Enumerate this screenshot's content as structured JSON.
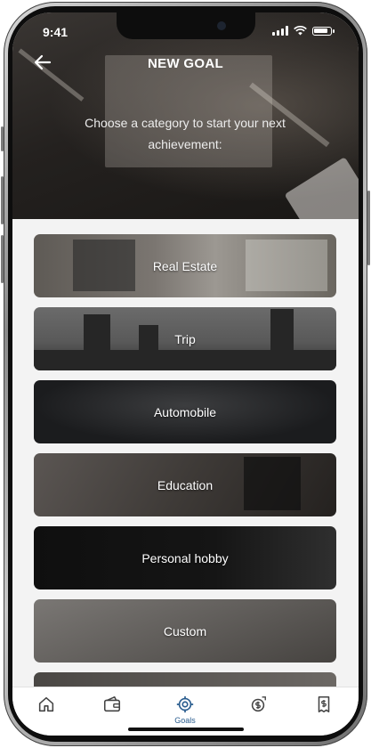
{
  "status_bar": {
    "time": "9:41"
  },
  "header": {
    "title": "NEW GOAL",
    "subtitle": "Choose a category to start your next achievement:"
  },
  "categories": [
    {
      "label": "Real Estate"
    },
    {
      "label": "Trip"
    },
    {
      "label": "Automobile"
    },
    {
      "label": "Education"
    },
    {
      "label": "Personal hobby"
    },
    {
      "label": "Custom"
    }
  ],
  "tabbar": {
    "active_label": "Goals",
    "items": [
      {
        "icon": "home-icon"
      },
      {
        "icon": "wallet-icon"
      },
      {
        "icon": "target-icon",
        "label": "Goals"
      },
      {
        "icon": "money-transfer-icon"
      },
      {
        "icon": "receipt-icon"
      }
    ]
  },
  "colors": {
    "accent": "#2a5d8f",
    "card_text": "#ffffff",
    "list_bg": "#f3f3f3"
  }
}
